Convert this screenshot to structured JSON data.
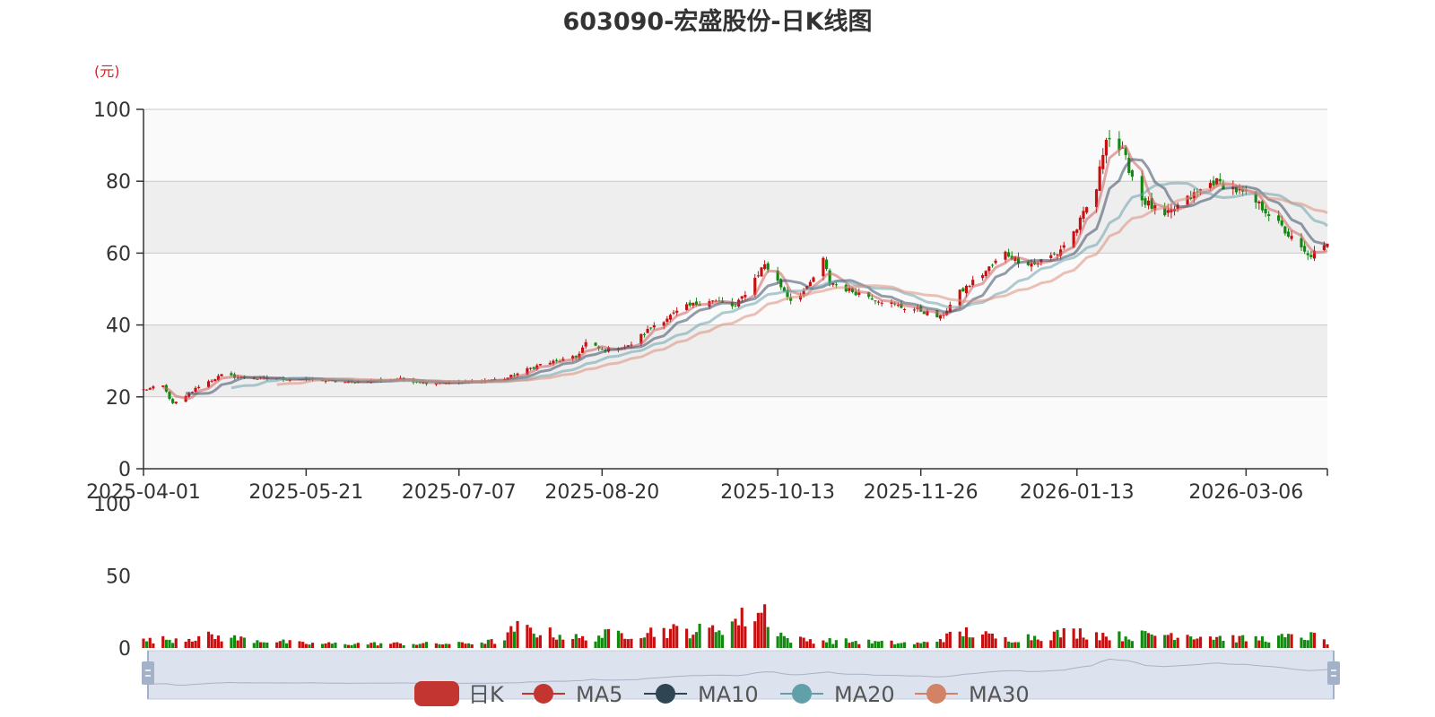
{
  "chart_data": {
    "type": "candlestick",
    "title": "603090-宏盛股份-日K线图",
    "price_unit": "(元)",
    "price_axis": {
      "ylim": [
        0,
        100
      ],
      "ticks": [
        0,
        20,
        40,
        60,
        80,
        100
      ]
    },
    "volume_axis": {
      "ylim": [
        0,
        100
      ],
      "ticks": [
        0,
        50,
        100
      ]
    },
    "x_tick_labels": [
      "2025-04-01",
      "2025-05-21",
      "2025-07-07",
      "2025-08-20",
      "2025-10-13",
      "2025-11-26",
      "2026-01-13",
      "2026-03-06"
    ],
    "date_range": [
      "2025-04-01",
      "2026-03-31"
    ],
    "up_color": "#c80f10",
    "down_color": "#118a0f",
    "series_colors": {
      "MA5": "#d06060",
      "MA10": "#3c4e66",
      "MA20": "#6ea3ad",
      "MA30": "#dc907c"
    },
    "legend": [
      {
        "name": "日K",
        "color": "#c23531"
      },
      {
        "name": "MA5",
        "color": "#c23531"
      },
      {
        "name": "MA10",
        "color": "#2f4554"
      },
      {
        "name": "MA20",
        "color": "#61a0a8"
      },
      {
        "name": "MA30",
        "color": "#d48265"
      }
    ],
    "price_path": {
      "dates": [
        "2025-04-01",
        "2025-04-07",
        "2025-04-10",
        "2025-04-14",
        "2025-04-18",
        "2025-04-25",
        "2025-05-06",
        "2025-05-21",
        "2025-06-03",
        "2025-06-18",
        "2025-06-27",
        "2025-07-07",
        "2025-07-21",
        "2025-08-01",
        "2025-08-12",
        "2025-08-15",
        "2025-08-20",
        "2025-08-28",
        "2025-09-05",
        "2025-09-15",
        "2025-09-22",
        "2025-09-30",
        "2025-10-09",
        "2025-10-13",
        "2025-10-17",
        "2025-10-22",
        "2025-10-27",
        "2025-10-29",
        "2025-11-03",
        "2025-11-10",
        "2025-11-20",
        "2025-11-26",
        "2025-12-02",
        "2025-12-08",
        "2025-12-16",
        "2025-12-22",
        "2025-12-26",
        "2025-12-31",
        "2026-01-07",
        "2026-01-13",
        "2026-01-19",
        "2026-01-22",
        "2026-01-27",
        "2026-02-02",
        "2026-02-09",
        "2026-02-13",
        "2026-02-24",
        "2026-03-02",
        "2026-03-06",
        "2026-03-12",
        "2026-03-20",
        "2026-03-25",
        "2026-03-31"
      ],
      "close": [
        22,
        23,
        18,
        20,
        23,
        26,
        25,
        25,
        24,
        25,
        24,
        24,
        25,
        29,
        31,
        35,
        33,
        34,
        40,
        45,
        47,
        45,
        57,
        52,
        47,
        50,
        58,
        52,
        50,
        48,
        45,
        44,
        42,
        49,
        55,
        60,
        58,
        57,
        60,
        67,
        78,
        93,
        88,
        75,
        70,
        73,
        80,
        78,
        76,
        72,
        64,
        59,
        62
      ]
    },
    "volume_samples": {
      "dates": [
        "2025-04-01",
        "2025-04-21",
        "2025-05-21",
        "2025-07-07",
        "2025-07-21",
        "2025-07-24",
        "2025-08-15",
        "2025-08-20",
        "2025-09-08",
        "2025-09-22",
        "2025-10-09",
        "2025-10-13",
        "2025-10-16",
        "2025-11-26",
        "2025-12-10",
        "2025-12-22",
        "2026-01-13",
        "2026-01-27",
        "2026-02-13",
        "2026-03-06",
        "2026-03-27",
        "2026-03-31"
      ],
      "values": [
        5,
        8,
        3,
        3,
        5,
        14,
        6,
        9,
        12,
        12,
        26,
        12,
        6,
        3,
        11,
        6,
        11,
        8,
        10,
        6,
        8,
        4
      ]
    }
  }
}
